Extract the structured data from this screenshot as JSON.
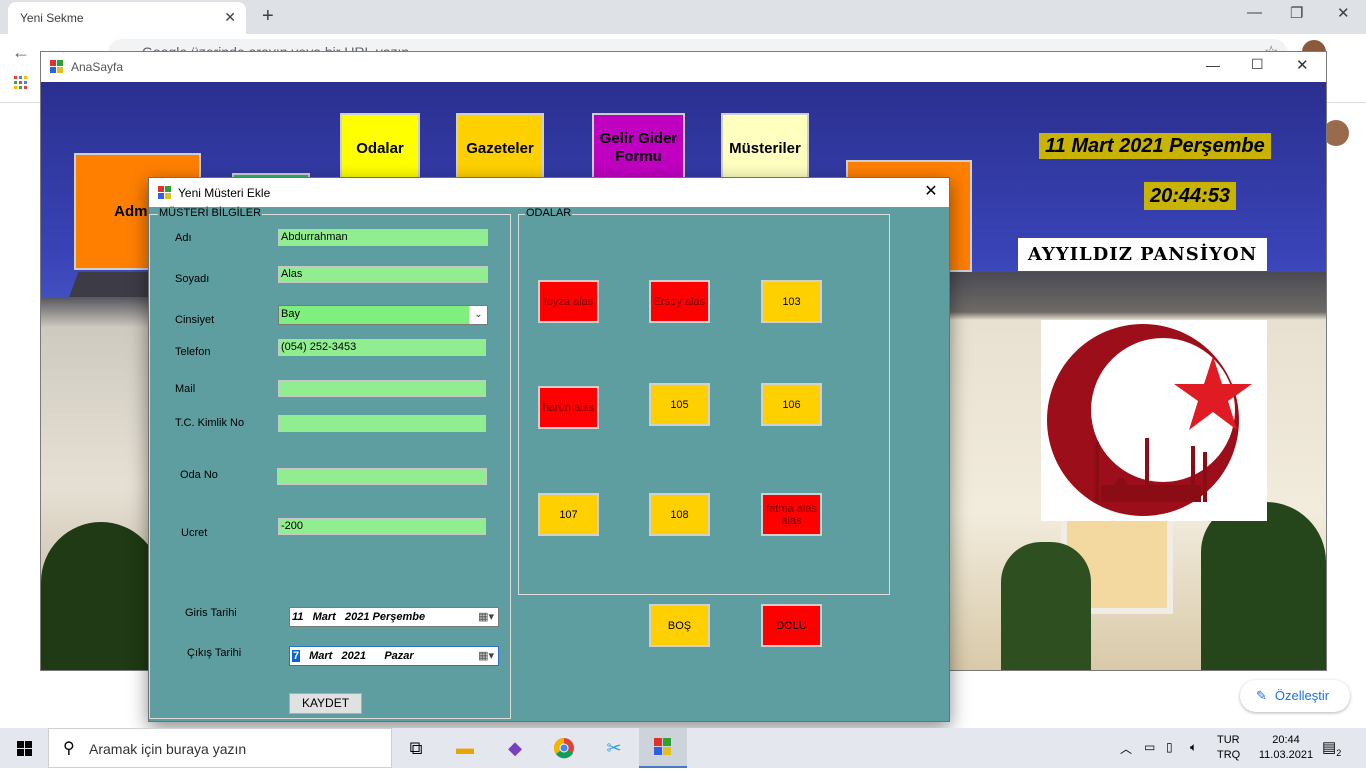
{
  "browser": {
    "tab_title": "Yeni Sekme",
    "omnibox_placeholder": "Google üzerinde arayın veya bir URL yazın",
    "customize_label": "Özelleştir"
  },
  "main_form": {
    "title": "AnaSayfa",
    "tiles": {
      "admin": "Admin",
      "odalar": "Odalar",
      "gazeteler": "Gazeteler",
      "gelir_gider": "Gelir Gider Formu",
      "musteriler": "Müsteriler"
    },
    "date": "11 Mart 2021 Perşembe",
    "time": "20:44:53",
    "brand": "AYYILDIZ PANSİYON"
  },
  "dialog": {
    "title": "Yeni Müsteri Ekle",
    "customer_group": "MÜSTERİ BİLGİLER",
    "rooms_group": "ODALAR",
    "labels": {
      "name": "Adı",
      "surname": "Soyadı",
      "gender": "Cinsiyet",
      "phone": "Telefon",
      "mail": "Mail",
      "tc": "T.C. Kimlik No",
      "room_no": "Oda No",
      "fee": "Ucret",
      "checkin": "Giris Tarihi",
      "checkout": "Çıkış Tarihi"
    },
    "values": {
      "name": "Abdurrahman",
      "surname": "Alas",
      "gender": "Bay",
      "phone": "(054) 252-3453",
      "mail": "",
      "tc": "",
      "room_no": "",
      "fee": "-200",
      "checkin": "11   Mart   2021 Perşembe",
      "checkout_day": "7",
      "checkout_rest": "  Mart   2021      Pazar"
    },
    "rooms": [
      {
        "label": "feyza  alas",
        "status": "full"
      },
      {
        "label": "Ersoy alas",
        "status": "full"
      },
      {
        "label": "103",
        "status": "empty"
      },
      {
        "label": "harun alas",
        "status": "full"
      },
      {
        "label": "105",
        "status": "empty"
      },
      {
        "label": "106",
        "status": "empty"
      },
      {
        "label": "107",
        "status": "empty"
      },
      {
        "label": "108",
        "status": "empty"
      },
      {
        "label": "fatma alas alas",
        "status": "full"
      }
    ],
    "legend": {
      "empty": "BOŞ",
      "full": "DOLU"
    },
    "save_label": "KAYDET",
    "colors": {
      "background": "#5f9ea0",
      "field": "#90ee90",
      "empty_room": "#ffd000",
      "full_room": "#ff0000"
    }
  },
  "taskbar": {
    "search_placeholder": "Aramak için buraya yazın",
    "lang_line1": "TUR",
    "lang_line2": "TRQ",
    "clock_time": "20:44",
    "clock_date": "11.03.2021",
    "notification_count": "2"
  }
}
